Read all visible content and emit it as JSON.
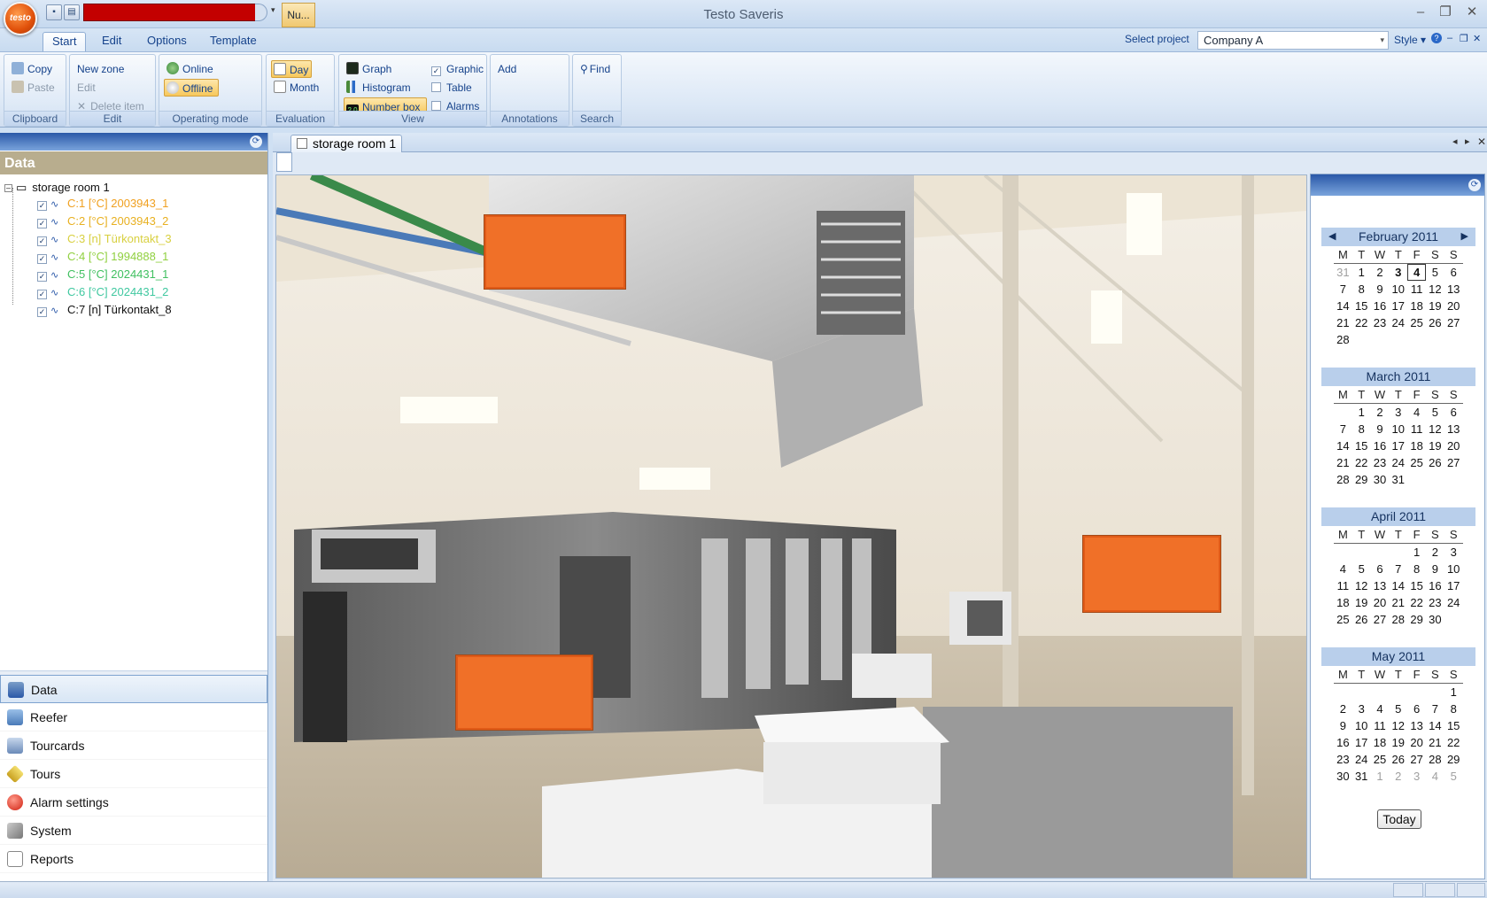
{
  "app": {
    "title": "Testo Saveris",
    "logo_text": "testo",
    "qat_tab": "Nu..."
  },
  "ribbon_tabs": [
    "Start",
    "Edit",
    "Options",
    "Template"
  ],
  "project": {
    "label": "Select project",
    "value": "Company A"
  },
  "style_menu": "Style",
  "ribbon": {
    "clipboard": {
      "label": "Clipboard",
      "copy": "Copy",
      "paste": "Paste"
    },
    "edit": {
      "label": "Edit",
      "new_zone": "New zone",
      "edit": "Edit",
      "delete_item": "Delete item"
    },
    "operating_mode": {
      "label": "Operating mode",
      "online": "Online",
      "offline": "Offline"
    },
    "evaluation": {
      "label": "Evaluation",
      "day": "Day",
      "month": "Month"
    },
    "view": {
      "label": "View",
      "graph": "Graph",
      "histogram": "Histogram",
      "number_box": "Number box",
      "graphic": "Graphic",
      "table": "Table",
      "alarms": "Alarms",
      "graphic_checked": true,
      "table_checked": false,
      "alarms_checked": false
    },
    "annotations": {
      "label": "Annotations",
      "add": "Add"
    },
    "search": {
      "label": "Search",
      "find": "Find"
    }
  },
  "left_panel": {
    "title": "Data",
    "tree_root": "storage room 1",
    "channels": [
      {
        "label": "C:1 [°C] 2003943_1",
        "color": "#f0a020"
      },
      {
        "label": "C:2 [°C] 2003943_2",
        "color": "#e8b020"
      },
      {
        "label": "C:3 [n] Türkontakt_3",
        "color": "#d8d040"
      },
      {
        "label": "C:4 [°C] 1994888_1",
        "color": "#90d040"
      },
      {
        "label": "C:5 [°C] 2024431_1",
        "color": "#40c060"
      },
      {
        "label": "C:6 [°C] 2024431_2",
        "color": "#40c8a0"
      },
      {
        "label": "C:7 [n] Türkontakt_8",
        "color": "#111111"
      }
    ]
  },
  "nav": [
    "Data",
    "Reefer",
    "Tourcards",
    "Tours",
    "Alarm settings",
    "System",
    "Reports"
  ],
  "document": {
    "tab": "storage room 1"
  },
  "calendar": {
    "dow": [
      "M",
      "T",
      "W",
      "T",
      "F",
      "S",
      "S"
    ],
    "months": [
      {
        "title": "February 2011",
        "weeks": [
          [
            "31",
            "1",
            "2",
            "3",
            "4",
            "5",
            "6"
          ],
          [
            "7",
            "8",
            "9",
            "10",
            "11",
            "12",
            "13"
          ],
          [
            "14",
            "15",
            "16",
            "17",
            "18",
            "19",
            "20"
          ],
          [
            "21",
            "22",
            "23",
            "24",
            "25",
            "26",
            "27"
          ],
          [
            "28",
            "",
            "",
            "",
            "",
            "",
            ""
          ]
        ]
      },
      {
        "title": "March 2011",
        "weeks": [
          [
            "",
            "1",
            "2",
            "3",
            "4",
            "5",
            "6"
          ],
          [
            "7",
            "8",
            "9",
            "10",
            "11",
            "12",
            "13"
          ],
          [
            "14",
            "15",
            "16",
            "17",
            "18",
            "19",
            "20"
          ],
          [
            "21",
            "22",
            "23",
            "24",
            "25",
            "26",
            "27"
          ],
          [
            "28",
            "29",
            "30",
            "31",
            "",
            "",
            ""
          ]
        ]
      },
      {
        "title": "April 2011",
        "weeks": [
          [
            "",
            "",
            "",
            "",
            "1",
            "2",
            "3"
          ],
          [
            "4",
            "5",
            "6",
            "7",
            "8",
            "9",
            "10"
          ],
          [
            "11",
            "12",
            "13",
            "14",
            "15",
            "16",
            "17"
          ],
          [
            "18",
            "19",
            "20",
            "21",
            "22",
            "23",
            "24"
          ],
          [
            "25",
            "26",
            "27",
            "28",
            "29",
            "30",
            ""
          ]
        ]
      },
      {
        "title": "May 2011",
        "weeks": [
          [
            "",
            "",
            "",
            "",
            "",
            "",
            "1"
          ],
          [
            "2",
            "3",
            "4",
            "5",
            "6",
            "7",
            "8"
          ],
          [
            "9",
            "10",
            "11",
            "12",
            "13",
            "14",
            "15"
          ],
          [
            "16",
            "17",
            "18",
            "19",
            "20",
            "21",
            "22"
          ],
          [
            "23",
            "24",
            "25",
            "26",
            "27",
            "28",
            "29"
          ],
          [
            "30",
            "31",
            "1",
            "2",
            "3",
            "4",
            "5"
          ]
        ]
      }
    ],
    "today_button": "Today"
  },
  "colors": {
    "accent": "#15428b",
    "orange_box": "#f07028",
    "panel_header": "#2a58a8",
    "data_header": "#b8ad8e"
  }
}
